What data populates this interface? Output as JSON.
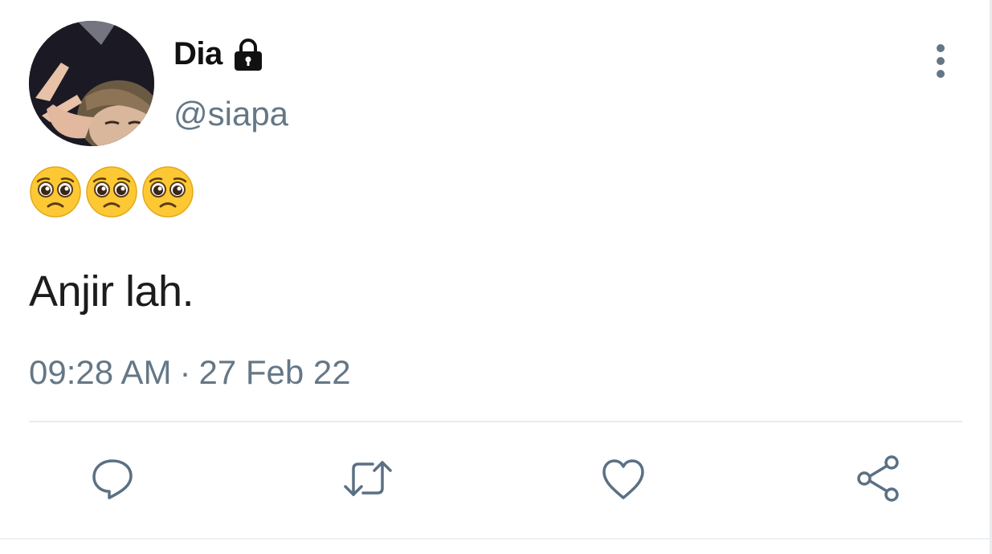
{
  "user": {
    "display_name": "Dia",
    "handle": "@siapa",
    "avatar_icon": "profile-photo",
    "protected_icon": "lock-icon"
  },
  "tweet": {
    "emoji": [
      "🥺",
      "🥺",
      "🥺"
    ],
    "text": "Anjir lah.",
    "time": "09:28 AM",
    "separator": "·",
    "date": "27 Feb 22"
  },
  "actions": [
    {
      "name": "reply",
      "icon": "reply-icon"
    },
    {
      "name": "retweet",
      "icon": "retweet-icon"
    },
    {
      "name": "like",
      "icon": "heart-icon"
    },
    {
      "name": "share",
      "icon": "share-icon"
    }
  ],
  "colors": {
    "secondary_text": "#657786",
    "icon": "#5b7083",
    "divider": "#e6ecf0"
  }
}
